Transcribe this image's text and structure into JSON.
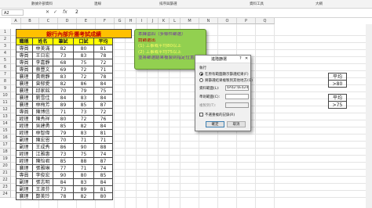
{
  "ribbon": {
    "items": [
      "數據外部資料",
      "連線",
      "排序與篩選",
      "資料工具",
      "大綱"
    ]
  },
  "formula_bar": {
    "name_box": "A2",
    "cancel": "✕",
    "confirm": "✓",
    "fx": "fx",
    "value": "2"
  },
  "columns": [
    "A",
    "B",
    "C",
    "D",
    "E",
    "F",
    "G",
    "H",
    "I",
    "J",
    "K",
    "L",
    "M",
    "N",
    "O",
    "P",
    "Q"
  ],
  "rows": [
    "1",
    "2",
    "3",
    "4",
    "5",
    "6",
    "7",
    "8",
    "9",
    "10",
    "11",
    "12",
    "13",
    "14",
    "15",
    "16",
    "17",
    "18",
    "19",
    "20",
    "21",
    "22",
    "23",
    "24"
  ],
  "title": "銀行內部升遷考試成績",
  "table": {
    "headers": [
      "職稱",
      "姓名",
      "筆試",
      "口試",
      "平均"
    ],
    "rows": [
      [
        "專員",
        "林美滿",
        "82",
        "80",
        "81"
      ],
      [
        "專員",
        "王日宏",
        "73",
        "83",
        "78"
      ],
      [
        "專員",
        "李嘉靜",
        "68",
        "75",
        "72"
      ],
      [
        "專員",
        "蔡豐文",
        "69",
        "72",
        "71"
      ],
      [
        "襄理",
        "黃雨靜",
        "83",
        "72",
        "78"
      ],
      [
        "襄理",
        "曾郁愛",
        "82",
        "86",
        "84"
      ],
      [
        "襄理",
        "邱家銘",
        "70",
        "79",
        "75"
      ],
      [
        "襄理",
        "劉雪佳",
        "84",
        "83",
        "84"
      ],
      [
        "襄理",
        "林梅芳",
        "89",
        "85",
        "87"
      ],
      [
        "專員",
        "陳博信",
        "71",
        "73",
        "72"
      ],
      [
        "經理",
        "陳秀祥",
        "80",
        "72",
        "76"
      ],
      [
        "經理",
        "吳建勇",
        "85",
        "82",
        "84"
      ],
      [
        "經理",
        "林智偉",
        "79",
        "83",
        "81"
      ],
      [
        "副理",
        "陳宏恩",
        "70",
        "71",
        "71"
      ],
      [
        "副理",
        "王成秀",
        "86",
        "90",
        "88"
      ],
      [
        "經理",
        "江雅惠",
        "73",
        "75",
        "74"
      ],
      [
        "經理",
        "陳怡君",
        "85",
        "88",
        "87"
      ],
      [
        "襄理",
        "張雅琳",
        "77",
        "71",
        "74"
      ],
      [
        "專員",
        "李俊宏",
        "90",
        "80",
        "85"
      ],
      [
        "副理",
        "張志明",
        "84",
        "83",
        "84"
      ],
      [
        "副理",
        "王淑芬",
        "73",
        "89",
        "81"
      ],
      [
        "襄理",
        "鄭美玲",
        "78",
        "82",
        "80"
      ]
    ]
  },
  "note": {
    "lines": [
      "本練習四（多條件篩選）",
      "請篩選出",
      "(1) 工事或平均80以上",
      "(2) 工事或平均75以上",
      "並將篩選結果複製到指定位置"
    ]
  },
  "criteria": {
    "row1": [
      "職稱",
      "姓名",
      "平均"
    ],
    "row2": [
      "襄理",
      "",
      ">80"
    ],
    "row3": [
      "經理",
      ""
    ],
    "right_label": "平均",
    "right_value": ">75"
  },
  "dialog": {
    "title": "進階篩選",
    "help": "?",
    "close": "✕",
    "section": "執行",
    "option1": "在原有範圍顯示篩選結果(F)",
    "option2": "將篩選結果複製到其他地方(O)",
    "list_range_label": "資料範圍(L):",
    "list_range_value": "$A$2:$E$24",
    "criteria_label": "準則範圍(C):",
    "criteria_value": "",
    "copy_to_label": "複製到(T):",
    "copy_to_value": "",
    "unique_label": "不選重複的記錄(R)",
    "ok": "確定",
    "cancel": "取消"
  }
}
